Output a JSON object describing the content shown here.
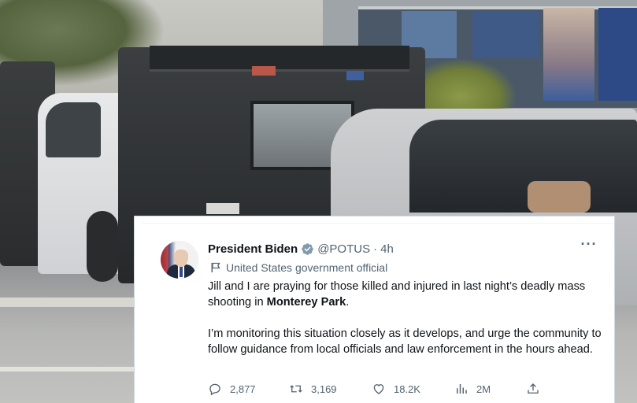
{
  "tweet": {
    "author_name": "President Biden",
    "handle": "@POTUS",
    "separator": "·",
    "time": "4h",
    "account_label": "United States government official",
    "text_line1_pre": "Jill and I are praying for those killed and injured in last night’s deadly mass shooting in ",
    "text_line1_bold": "Monterey Park",
    "text_line1_post": ".",
    "text_para2": "I’m monitoring this situation closely as it develops, and urge the community to follow guidance from local officials and law enforcement in the hours ahead.",
    "more_label": "···",
    "stats": {
      "replies": "2,877",
      "retweets": "3,169",
      "likes": "18.2K",
      "views": "2M"
    }
  },
  "colors": {
    "verified_badge": "#829aab",
    "secondary_text": "#536471",
    "primary_text": "#0f1419"
  },
  "icons": [
    "verified-badge-icon",
    "flag-icon",
    "more-icon",
    "reply-icon",
    "retweet-icon",
    "like-icon",
    "views-icon",
    "share-icon"
  ]
}
